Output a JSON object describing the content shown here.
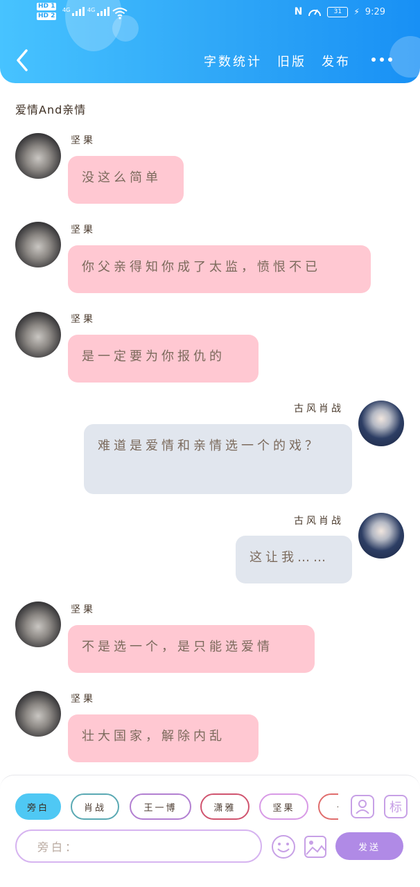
{
  "status_bar": {
    "sim1": "HD 1",
    "sim2": "HD 2",
    "net1": "4G",
    "net2": "4G",
    "battery": "31",
    "time": "9:29"
  },
  "header": {
    "actions": [
      "字数统计",
      "旧版",
      "发布"
    ]
  },
  "chat_title": "爱情And亲情",
  "messages": [
    {
      "side": "left",
      "sender": "坚果",
      "text": "没这么简单",
      "avatar": "cat"
    },
    {
      "side": "left",
      "sender": "坚果",
      "text": "你父亲得知你成了太监，愤恨不已",
      "avatar": "cat"
    },
    {
      "side": "left",
      "sender": "坚果",
      "text": "是一定要为你报仇的",
      "avatar": "cat"
    },
    {
      "side": "right",
      "sender": "古风肖战",
      "text": "难道是爱情和亲情选一个的戏？",
      "avatar": "man"
    },
    {
      "side": "right",
      "sender": "古风肖战",
      "text": "这让我……",
      "avatar": "man"
    },
    {
      "side": "left",
      "sender": "坚果",
      "text": "不是选一个，是只能选爱情",
      "avatar": "cat"
    },
    {
      "side": "left",
      "sender": "坚果",
      "text": "壮大国家，解除内乱",
      "avatar": "cat"
    }
  ],
  "roles": [
    {
      "label": "旁白",
      "color": "#4fc8f4",
      "active": true
    },
    {
      "label": "肖战",
      "color": "#5aa9b3",
      "active": false
    },
    {
      "label": "王一博",
      "color": "#b27fd1",
      "active": false
    },
    {
      "label": "潇雅",
      "color": "#d0546f",
      "active": false
    },
    {
      "label": "坚果",
      "color": "#d89ae6",
      "active": false
    },
    {
      "label": "公",
      "color": "#e06d6d",
      "active": false
    }
  ],
  "tools": {
    "role_icon": "person-card-icon",
    "mark_label": "标",
    "emoji_icon": "smiley-icon",
    "image_icon": "image-icon"
  },
  "composer": {
    "placeholder": "旁白：",
    "send_label": "发送"
  }
}
